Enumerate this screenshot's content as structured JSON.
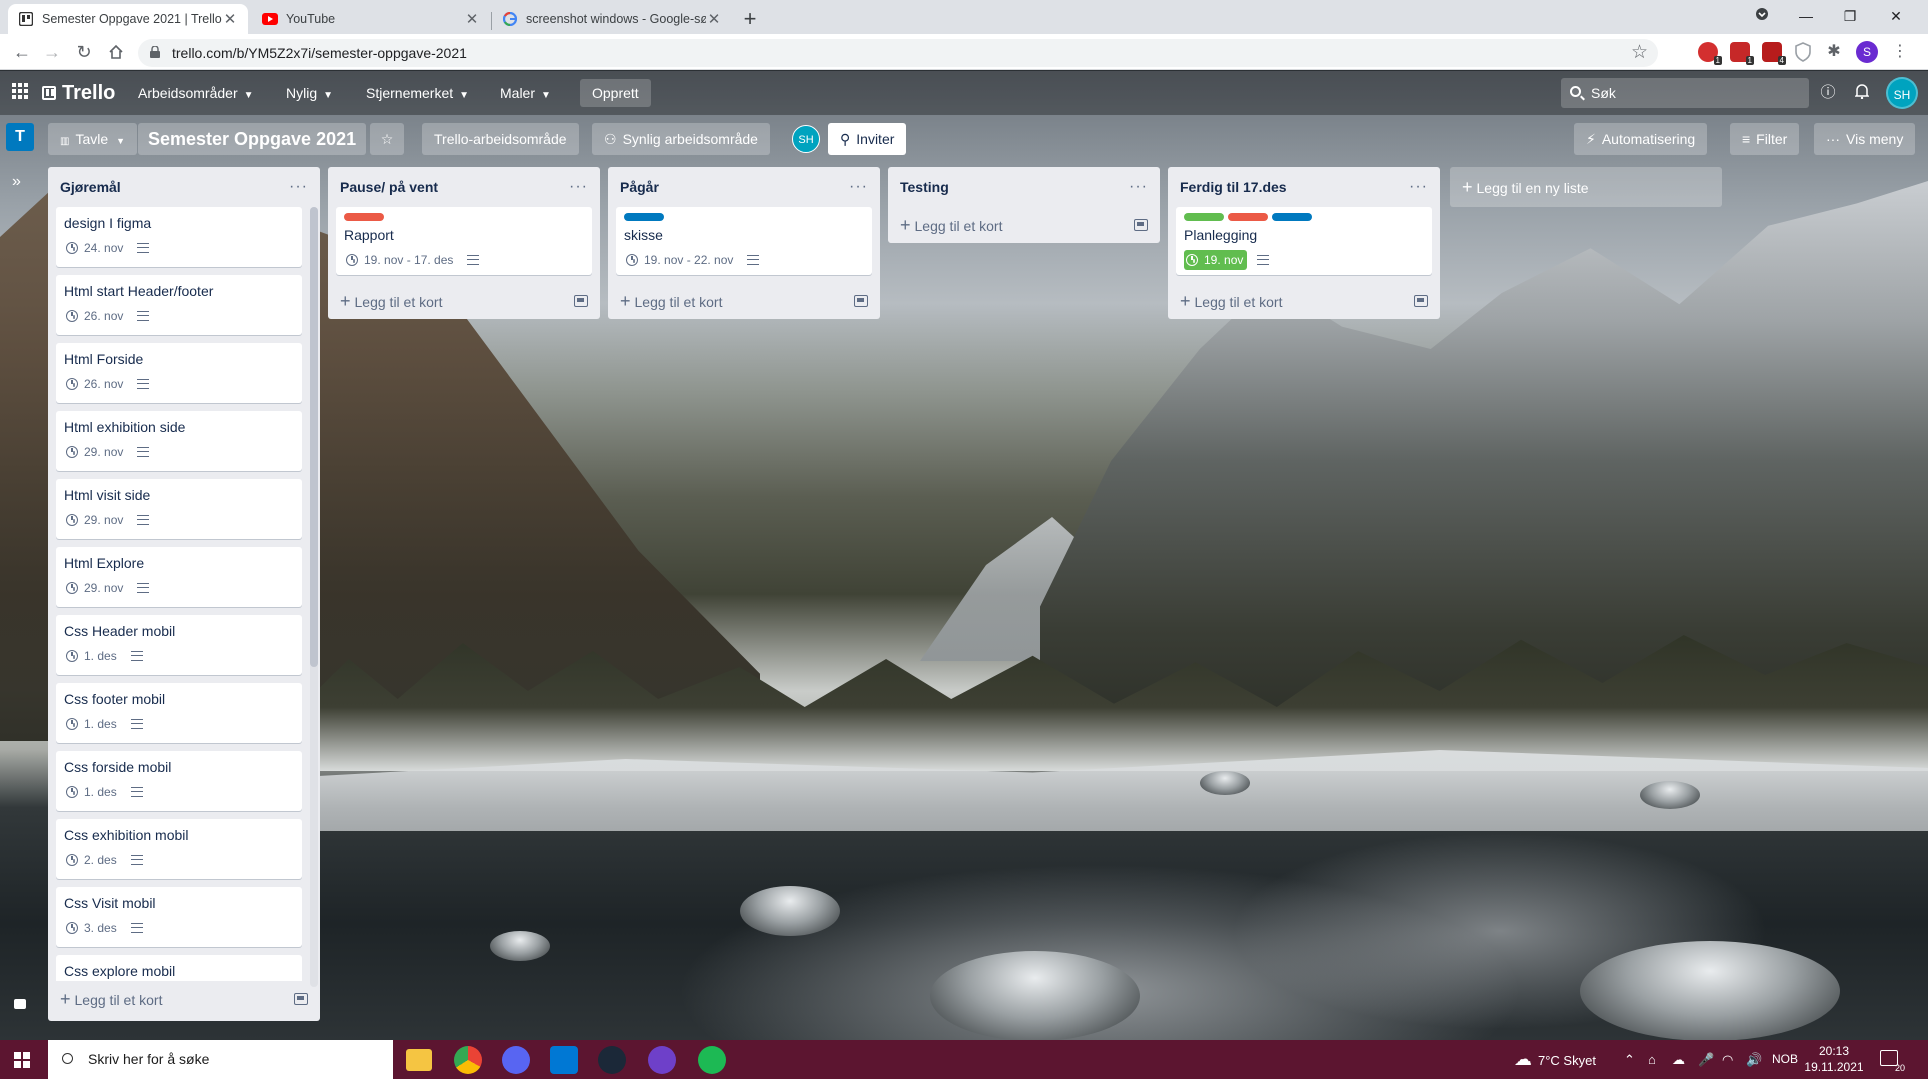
{
  "browser": {
    "tabs": [
      {
        "title": "Semester Oppgave 2021 | Trello",
        "icon": "trello-favicon-icon",
        "active": true
      },
      {
        "title": "YouTube",
        "icon": "youtube-favicon-icon",
        "active": false
      },
      {
        "title": "screenshot windows - Google-sø",
        "icon": "google-favicon-icon",
        "active": false
      }
    ],
    "url": "trello.com/b/YM5Z2x7i/semester-oppgave-2021",
    "extension_badges": [
      "1",
      "1",
      "4"
    ],
    "profile_initial": "S"
  },
  "trello_header": {
    "logo": "Trello",
    "menus": [
      "Arbeidsområder",
      "Nylig",
      "Stjernemerket",
      "Maler"
    ],
    "create": "Opprett",
    "search_placeholder": "Søk",
    "avatar": "SH"
  },
  "board_header": {
    "workspace_letter": "T",
    "view": "Tavle",
    "title": "Semester Oppgave 2021",
    "workspace": "Trello-arbeidsområde",
    "visibility": "Synlig arbeidsområde",
    "member": "SH",
    "invite": "Inviter",
    "automation": "Automatisering",
    "filter": "Filter",
    "menu": "Vis meny"
  },
  "lists": [
    {
      "title": "Gjøremål",
      "cards": [
        {
          "title": "design I figma",
          "due": "24. nov"
        },
        {
          "title": "Html start Header/footer",
          "due": "26. nov"
        },
        {
          "title": "Html Forside",
          "due": "26. nov"
        },
        {
          "title": "Html exhibition side",
          "due": "29. nov"
        },
        {
          "title": "Html visit side",
          "due": "29. nov"
        },
        {
          "title": "Html Explore",
          "due": "29. nov"
        },
        {
          "title": "Css Header mobil",
          "due": "1. des"
        },
        {
          "title": "Css footer mobil",
          "due": "1. des"
        },
        {
          "title": "Css forside mobil",
          "due": "1. des"
        },
        {
          "title": "Css exhibition mobil",
          "due": "2. des"
        },
        {
          "title": "Css Visit mobil",
          "due": "3. des"
        },
        {
          "title": "Css explore mobil",
          "due": ""
        }
      ],
      "add_card": "Legg til et kort"
    },
    {
      "title": "Pause/ på vent",
      "cards": [
        {
          "title": "Rapport",
          "due": "19. nov - 17. des",
          "labels": [
            "#eb5a46"
          ]
        }
      ],
      "add_card": "Legg til et kort"
    },
    {
      "title": "Pågår",
      "cards": [
        {
          "title": "skisse",
          "due": "19. nov - 22. nov",
          "labels": [
            "#0079bf"
          ]
        }
      ],
      "add_card": "Legg til et kort"
    },
    {
      "title": "Testing",
      "cards": [],
      "add_card": "Legg til et kort"
    },
    {
      "title": "Ferdig til 17.des",
      "cards": [
        {
          "title": "Planlegging",
          "due": "19. nov",
          "due_complete": true,
          "labels": [
            "#61bd4f",
            "#eb5a46",
            "#0079bf"
          ]
        }
      ],
      "add_card": "Legg til et kort"
    }
  ],
  "add_list": "Legg til en ny liste",
  "taskbar": {
    "search_placeholder": "Skriv her for å søke",
    "weather": "7°C  Skyet",
    "language": "NOB",
    "time": "20:13",
    "date": "19.11.2021",
    "notifications": "20"
  },
  "colors": {
    "trello_blue": "#0079bf",
    "list_bg": "#ebecf0",
    "label_green": "#61bd4f",
    "label_red": "#eb5a46",
    "label_blue": "#0079bf",
    "taskbar": "#5c1530"
  }
}
